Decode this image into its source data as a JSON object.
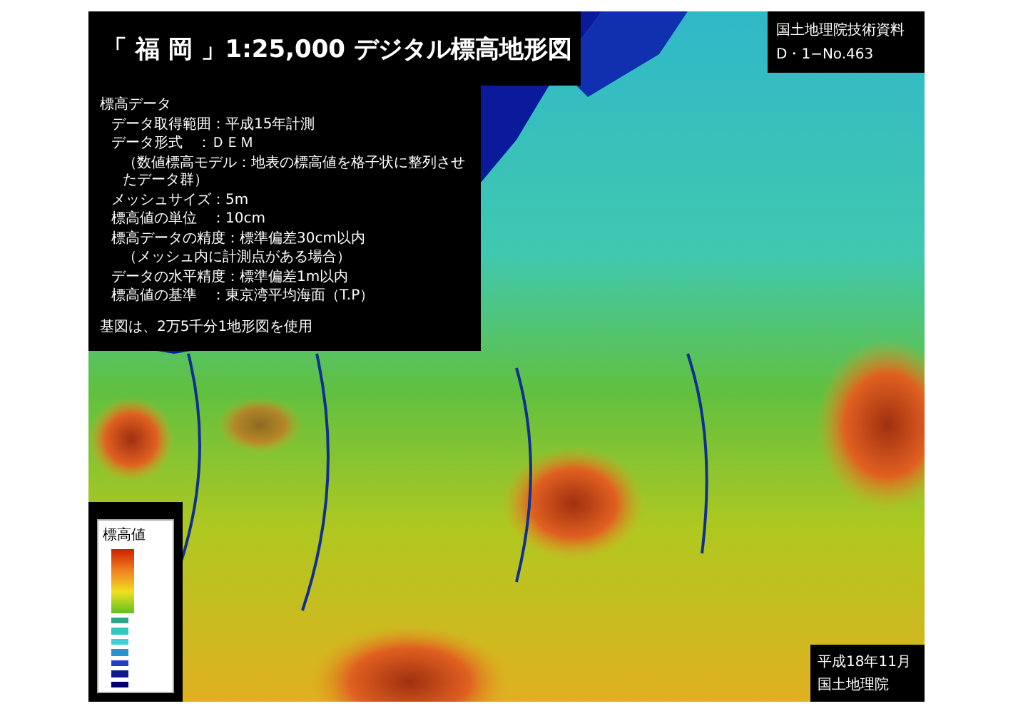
{
  "title": "「 福 岡 」1:25,000 デジタル標高地形図",
  "info": [
    {
      "kind": "heading",
      "text": "標高データ"
    },
    {
      "kind": "item",
      "text": "データ取得範囲：平成15年計測"
    },
    {
      "kind": "item",
      "text": "データ形式　：ＤＥＭ"
    },
    {
      "kind": "note",
      "text": "（数値標高モデル：地表の標高値を格子状に整列させたデータ群）"
    },
    {
      "kind": "item",
      "text": "メッシュサイズ：5m"
    },
    {
      "kind": "item",
      "text": "標高値の単位　：10cm"
    },
    {
      "kind": "item",
      "text": "標高データの精度：標準偏差30cm以内"
    },
    {
      "kind": "note",
      "text": "（メッシュ内に計測点がある場合）"
    },
    {
      "kind": "item",
      "text": "データの水平精度：標準偏差1m以内"
    },
    {
      "kind": "item",
      "text": "標高値の基準　：東京湾平均海面（T.P）"
    },
    {
      "kind": "footer",
      "text": "基図は、2万5千分1地形図を使用"
    }
  ],
  "corner_note": [
    "国土地理院技術資料",
    "D・1−No.463"
  ],
  "legend": {
    "title": "標高値",
    "swatches": [
      {
        "color": "#2fa58a"
      },
      {
        "color": "#30c8c0"
      },
      {
        "color": "#40d0d8"
      },
      {
        "color": "#2f8fc8"
      },
      {
        "color": "#2040c0"
      },
      {
        "color": "#101890"
      },
      {
        "color": "#000070"
      }
    ]
  },
  "footer": [
    "平成18年11月",
    "国土地理院"
  ]
}
